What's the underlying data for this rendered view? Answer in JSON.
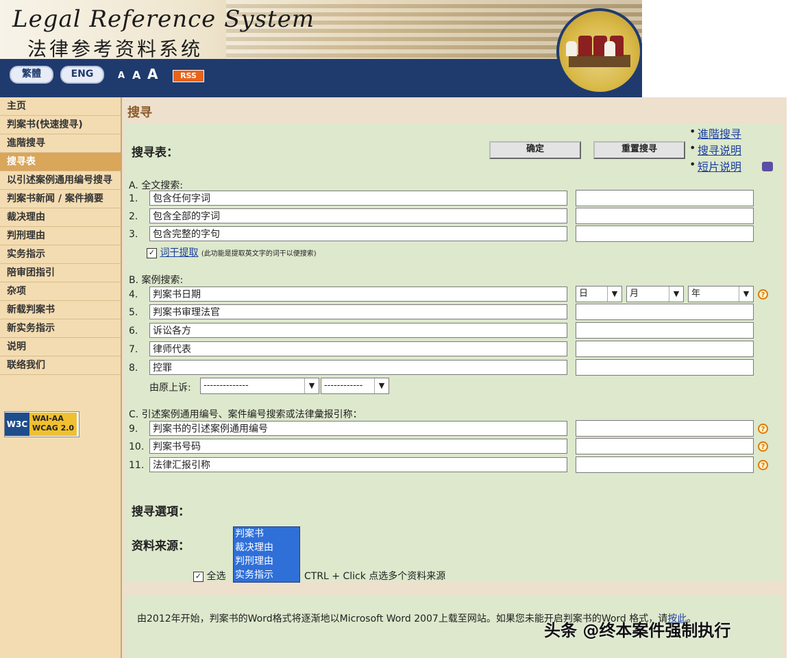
{
  "header": {
    "title_en": "Legal Reference System",
    "title_zh": "法律参考资料系统",
    "lang_trad": "繁體",
    "lang_eng": "ENG",
    "font_small": "A",
    "font_medium": "A",
    "font_large": "A",
    "rss": "RSS"
  },
  "sidebar": {
    "items": [
      {
        "label": "主页"
      },
      {
        "label": "判案书(快速搜寻)"
      },
      {
        "label": "進階搜寻"
      },
      {
        "label": "搜寻表"
      },
      {
        "label": "以引述案例通用编号搜寻"
      },
      {
        "label": "判案书新闻 / 案件摘要"
      },
      {
        "label": "裁决理由"
      },
      {
        "label": "判刑理由"
      },
      {
        "label": "实务指示"
      },
      {
        "label": "陪审团指引"
      },
      {
        "label": "杂项"
      },
      {
        "label": "新载判案书"
      },
      {
        "label": "新实务指示"
      },
      {
        "label": "说明"
      },
      {
        "label": "联络我们"
      }
    ],
    "badge_w3c": "W3C",
    "badge_wai_line1": "WAI-AA",
    "badge_wai_line2": "WCAG 2.0"
  },
  "main": {
    "page_title": "搜寻",
    "form_title": "搜寻表：",
    "submit_label": "确定",
    "reset_label": "重置搜寻",
    "links": [
      "進階搜寻",
      "搜寻说明",
      "短片说明"
    ],
    "section_a": "A. 全文搜索:",
    "rows_a": [
      {
        "num": "1.",
        "label": "包含任何字词"
      },
      {
        "num": "2.",
        "label": "包含全部的字词"
      },
      {
        "num": "3.",
        "label": "包含完整的字句"
      }
    ],
    "stem_label": "词干提取",
    "stem_note": "(此功能是提取英文字的词干以便搜索)",
    "section_b": "B. 案例搜索:",
    "rows_b": [
      {
        "num": "4.",
        "label": "判案书日期"
      },
      {
        "num": "5.",
        "label": "判案书审理法官"
      },
      {
        "num": "6.",
        "label": "诉讼各方"
      },
      {
        "num": "7.",
        "label": "律师代表"
      },
      {
        "num": "8.",
        "label": "控罪"
      }
    ],
    "date_day": "日",
    "date_month": "月",
    "date_year": "年",
    "appeal_label": "由原上诉:",
    "appeal_select1": "--------------",
    "appeal_select2": "------------",
    "section_c": "C. 引述案例通用编号、案件编号搜索或法律彙报引称：",
    "rows_c": [
      {
        "num": "9.",
        "label": "判案书的引述案例通用编号"
      },
      {
        "num": "10.",
        "label": "判案书号码"
      },
      {
        "num": "11.",
        "label": "法律汇报引称"
      }
    ],
    "options_title": "搜寻選項：",
    "source_label": "资料来源：",
    "source_options": [
      "判案书",
      "裁决理由",
      "判刑理由",
      "实务指示"
    ],
    "select_all": "全选",
    "ctrl_hint": "CTRL + Click 点选多个资料来源",
    "notice_text": "由2012年开始，判案书的Word格式将逐渐地以Microsoft Word 2007上载至网站。如果您未能开启判案书的Word 格式，请",
    "notice_link": "按此",
    "notice_end": "。"
  },
  "watermark": "头条 @终本案件强制执行"
}
